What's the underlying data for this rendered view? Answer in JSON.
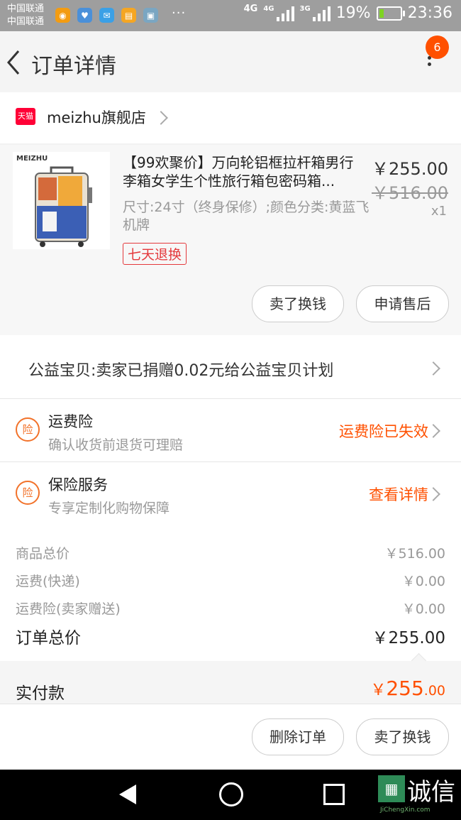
{
  "status_bar": {
    "carrier_1": "中国联通",
    "carrier_2": "中国联通",
    "dots": "···",
    "net_1": "4G",
    "net_2": "4G",
    "net_3": "3G",
    "battery": "19%",
    "time": "23:36",
    "icons": [
      "uc-browser-icon",
      "health-icon",
      "message-icon",
      "notes-icon",
      "gallery-icon"
    ]
  },
  "header": {
    "title": "订单详情",
    "badge_count": "6"
  },
  "store": {
    "logo_text": "天猫",
    "name": "meizhu旗舰店"
  },
  "product": {
    "brand": "MEIZHU",
    "title": "【99欢聚价】万向轮铝框拉杆箱男行李箱女学生个性旅行箱包密码箱...",
    "price": "￥255.00",
    "original_price": "￥516.00",
    "quantity": "x1",
    "sku": "尺寸:24寸（终身保修）;颜色分类:黄蓝飞机牌",
    "return_tag": "七天退换",
    "buttons": {
      "resell": "卖了换钱",
      "after_sale": "申请售后"
    }
  },
  "charity": {
    "text": "公益宝贝:卖家已捐赠0.02元给公益宝贝计划"
  },
  "insurance": [
    {
      "icon": "险",
      "title": "运费险",
      "subtitle": "确认收货前退货可理赔",
      "status": "运费险已失效"
    },
    {
      "icon": "险",
      "title": "保险服务",
      "subtitle": "专享定制化购物保障",
      "status": "查看详情"
    }
  ],
  "totals": {
    "goods_label": "商品总价",
    "goods_value": "￥516.00",
    "shipping_label": "运费(快递)",
    "shipping_value": "￥0.00",
    "shipping_ins_label": "运费险(卖家赠送)",
    "shipping_ins_value": "￥0.00",
    "order_total_label": "订单总价",
    "order_total_value": "￥255.00",
    "paid_label": "实付款",
    "paid_currency": "￥",
    "paid_int": "255",
    "paid_dec": ".00"
  },
  "actions": {
    "delete": "删除订单",
    "resell": "卖了换钱"
  },
  "watermark": {
    "text": "诚信",
    "sub": "JiChengXin.com"
  },
  "colors": {
    "accent": "#ff5000",
    "tmall": "#ff0036",
    "insurance_icon": "#f2722a"
  }
}
